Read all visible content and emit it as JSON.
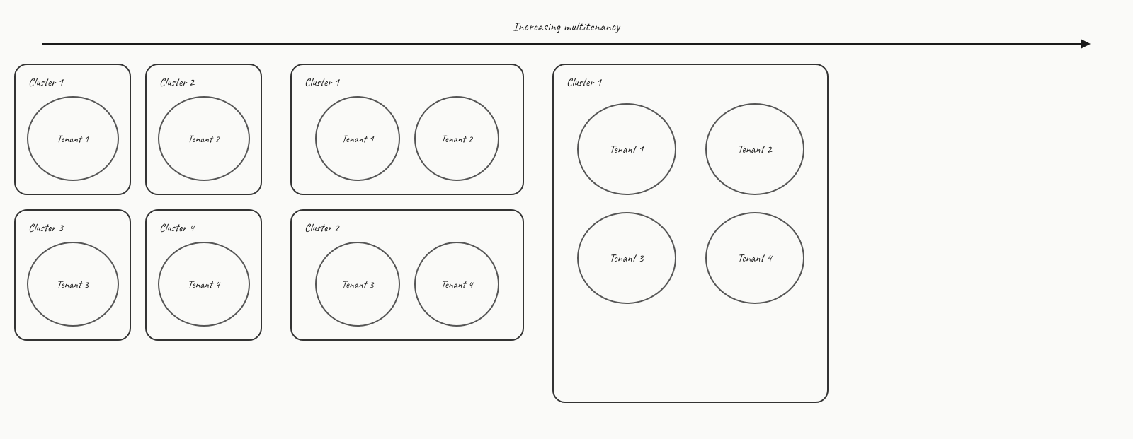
{
  "arrow": {
    "label": "Increasing multitenancy"
  },
  "section1": {
    "clusters": [
      {
        "id": "cluster-1",
        "label": "Cluster 1",
        "tenants": [
          {
            "id": "t1",
            "label": "Tenant 1"
          }
        ]
      },
      {
        "id": "cluster-2",
        "label": "Cluster 2",
        "tenants": [
          {
            "id": "t2",
            "label": "Tenant 2"
          }
        ]
      },
      {
        "id": "cluster-3",
        "label": "Cluster 3",
        "tenants": [
          {
            "id": "t3",
            "label": "Tenant 3"
          }
        ]
      },
      {
        "id": "cluster-4",
        "label": "Cluster 4",
        "tenants": [
          {
            "id": "t4",
            "label": "Tenant 4"
          }
        ]
      }
    ]
  },
  "section2": {
    "clusters": [
      {
        "id": "cluster-1",
        "label": "Cluster 1",
        "tenants": [
          {
            "id": "t1",
            "label": "Tenant 1"
          },
          {
            "id": "t2",
            "label": "Tenant 2"
          }
        ]
      },
      {
        "id": "cluster-2",
        "label": "Cluster 2",
        "tenants": [
          {
            "id": "t3",
            "label": "Tenant 3"
          },
          {
            "id": "t4",
            "label": "Tenant 4"
          }
        ]
      }
    ]
  },
  "section3": {
    "cluster": {
      "id": "cluster-1",
      "label": "Cluster 1",
      "tenants": [
        {
          "id": "t1",
          "label": "Tenant 1"
        },
        {
          "id": "t2",
          "label": "Tenant 2"
        },
        {
          "id": "t3",
          "label": "Tenant 3"
        },
        {
          "id": "t4",
          "label": "Tenant 4"
        }
      ]
    }
  }
}
